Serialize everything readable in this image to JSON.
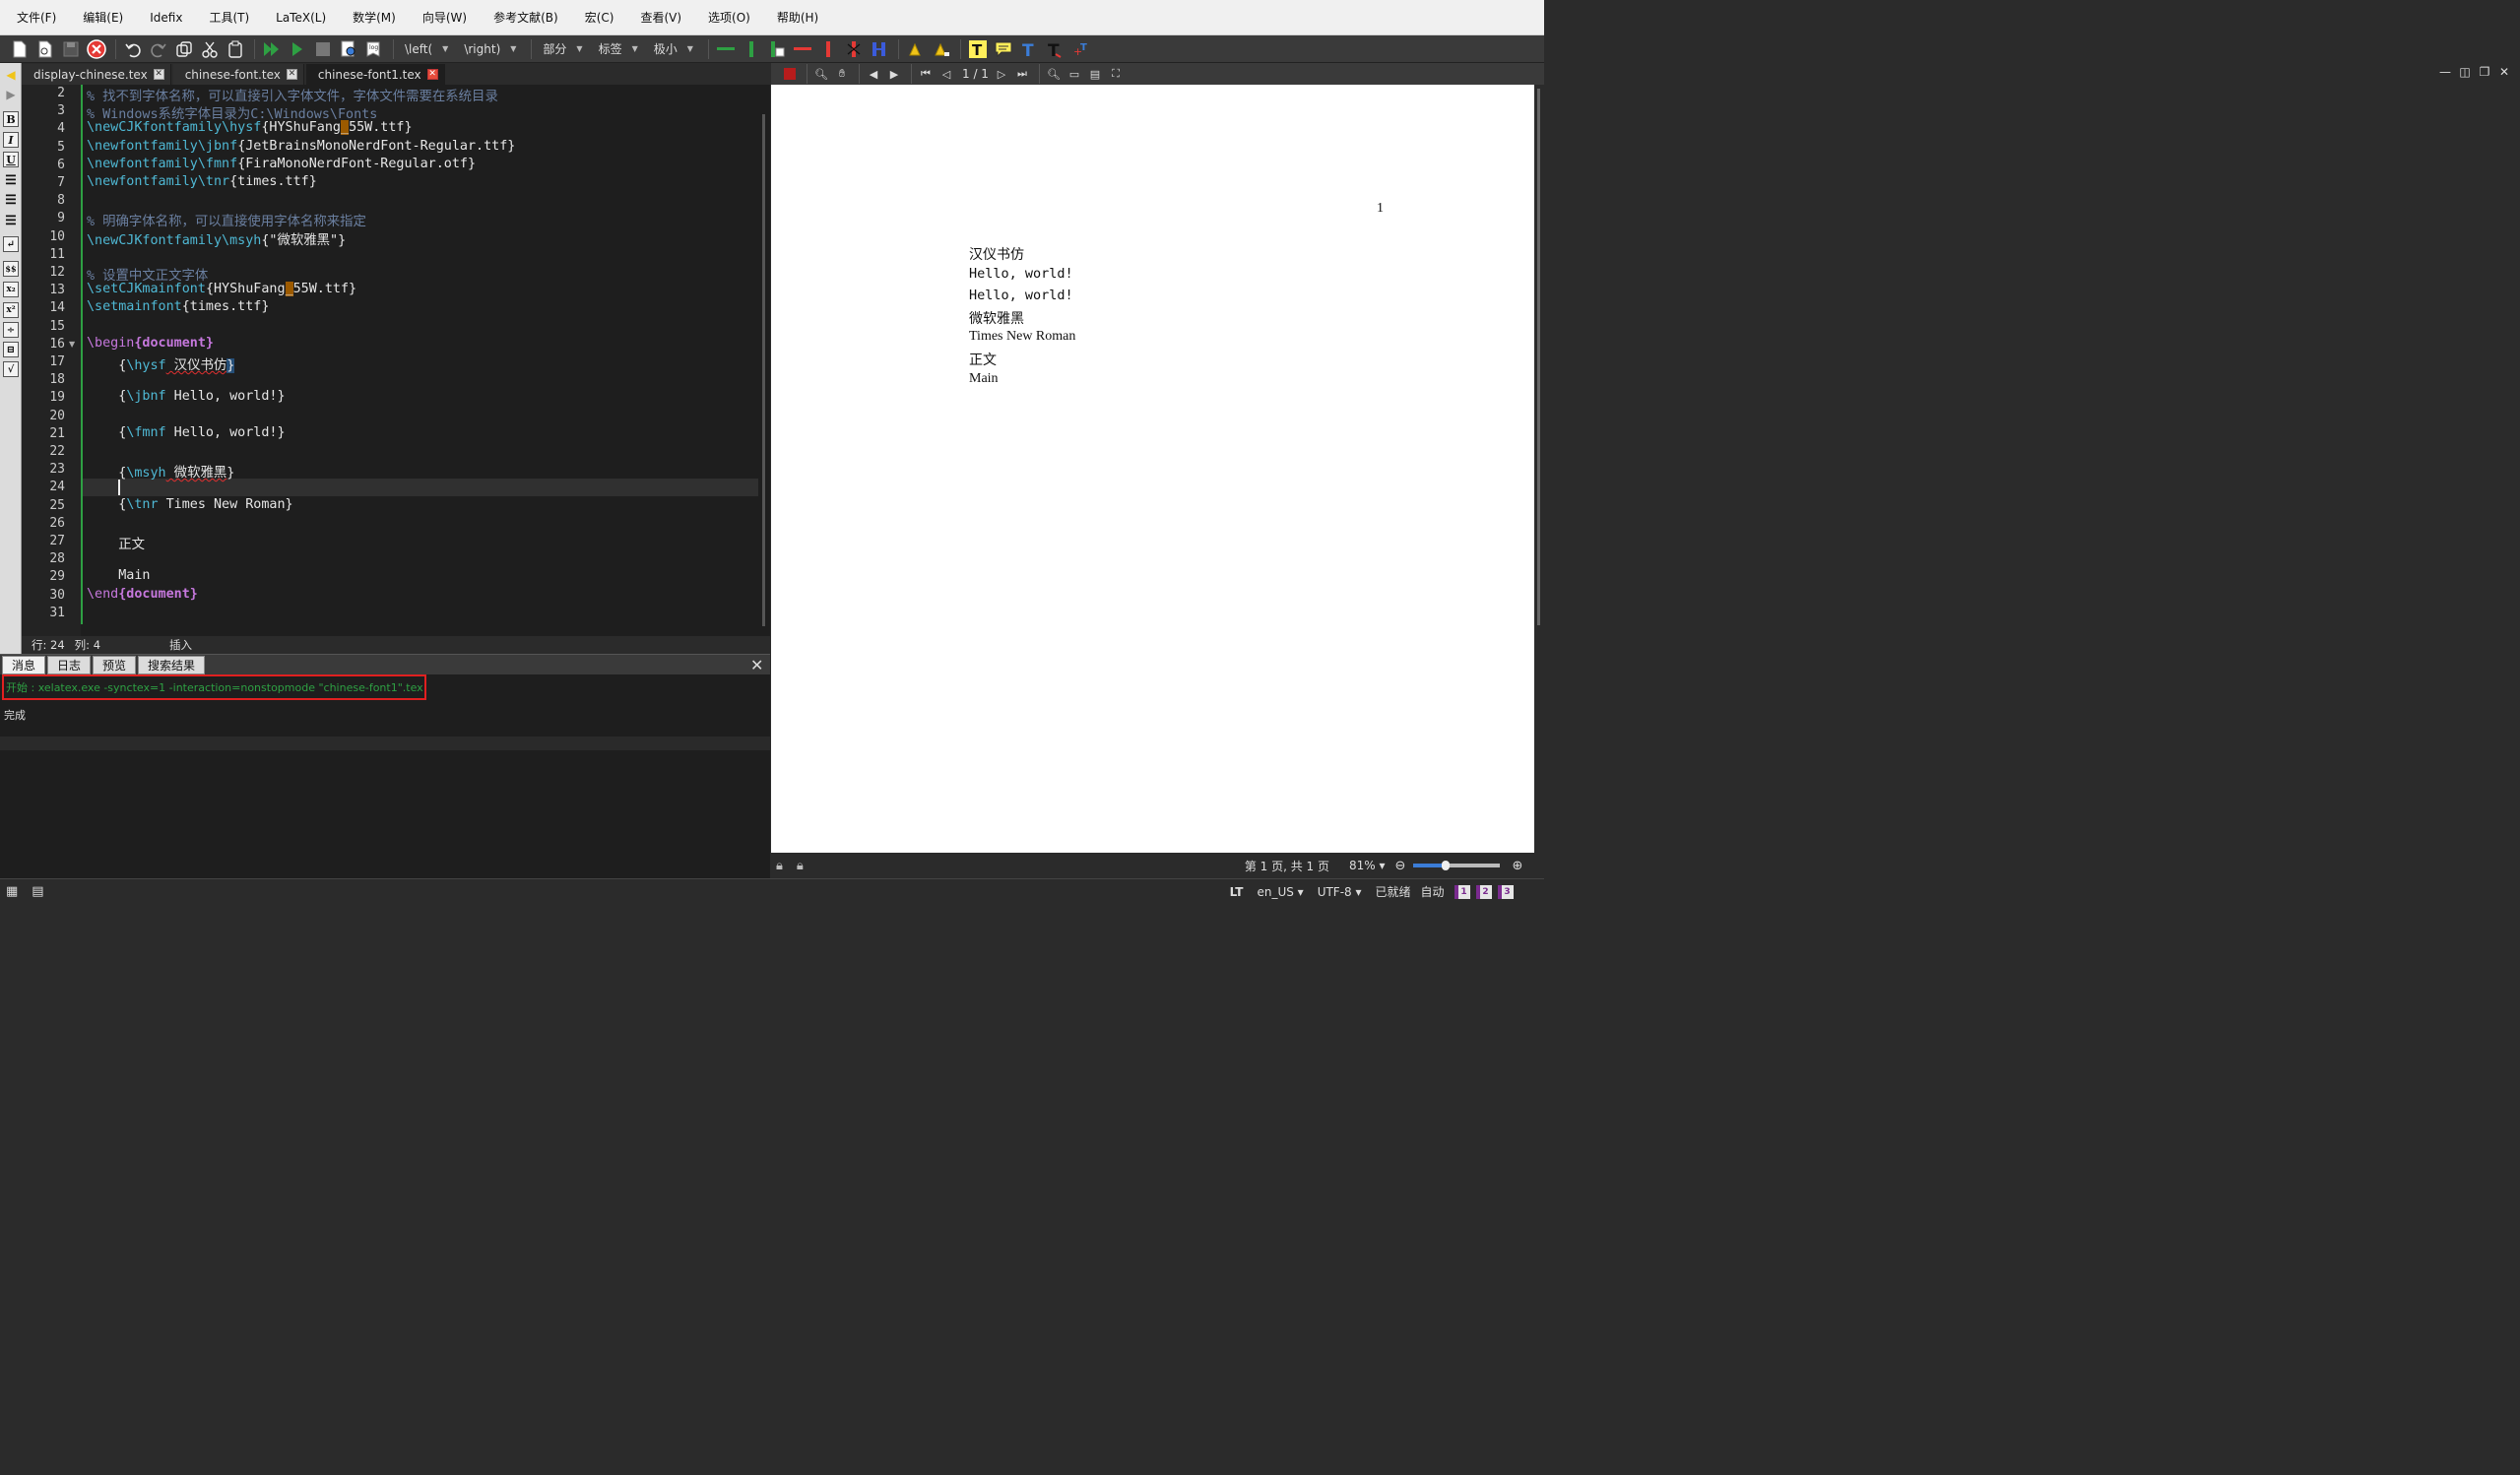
{
  "menu": [
    "文件(F)",
    "编辑(E)",
    "Idefix",
    "工具(T)",
    "LaTeX(L)",
    "数学(M)",
    "向导(W)",
    "参考文献(B)",
    "宏(C)",
    "查看(V)",
    "选项(O)",
    "帮助(H)"
  ],
  "toolbar": {
    "combo_left": "\\left(",
    "combo_right": "\\right)",
    "combo_part": "部分",
    "combo_label": "标签",
    "combo_size": "极小",
    "colors": {
      "compile": "#2ea043",
      "close": "#e53935",
      "accent_yellow": "#ffef5a"
    }
  },
  "tabs": [
    {
      "label": "display-chinese.tex",
      "active": false
    },
    {
      "label": "chinese-font.tex",
      "active": false
    },
    {
      "label": "chinese-font1.tex",
      "active": true
    }
  ],
  "editor": {
    "line_numbers": [
      "2",
      "3",
      "4",
      "5",
      "6",
      "7",
      "8",
      "9",
      "10",
      "11",
      "12",
      "13",
      "14",
      "15",
      "16",
      "17",
      "18",
      "19",
      "20",
      "21",
      "22",
      "23",
      "24",
      "25",
      "26",
      "27",
      "28",
      "29",
      "30",
      "31"
    ],
    "lines": {
      "l2": "% 找不到字体名称，可以直接引入字体文件，字体文件需要在系统目录",
      "l3": "% Windows系统字体目录为C:\\Windows\\Fonts",
      "l4_cmd": "\\newCJKfontfamily\\hysf",
      "l4_a": "{HYShuFang",
      "l4_b": "_",
      "l4_c": "55W.ttf}",
      "l5_cmd": "\\newfontfamily\\jbnf",
      "l5_arg": "{JetBrainsMonoNerdFont-Regular.ttf}",
      "l6_cmd": "\\newfontfamily\\fmnf",
      "l6_arg": "{FiraMonoNerdFont-Regular.otf}",
      "l7_cmd": "\\newfontfamily\\tnr",
      "l7_arg": "{times.ttf}",
      "l9": "% 明确字体名称，可以直接使用字体名称来指定",
      "l10_cmd": "\\newCJKfontfamily\\msyh",
      "l10_arg": "{\"微软雅黑\"}",
      "l12": "% 设置中文正文字体",
      "l13_cmd": "\\setCJKmainfont",
      "l13_a": "{HYShuFang",
      "l13_b": "_",
      "l13_c": "55W.ttf}",
      "l14_cmd": "\\setmainfont",
      "l14_arg": "{times.ttf}",
      "l16_cmd": "\\begin",
      "l16_env": "{document}",
      "l17_open": "    {",
      "l17_cmd": "\\hysf",
      "l17_text": " 汉仪书仿",
      "l17_close": "}",
      "l19_open": "    {",
      "l19_cmd": "\\jbnf",
      "l19_text": " Hello, world!}",
      "l21_open": "    {",
      "l21_cmd": "\\fmnf",
      "l21_text": " Hello, world!}",
      "l23_open": "    {",
      "l23_cmd": "\\msyh",
      "l23_text": " 微软雅黑",
      "l23_close": "}",
      "l25_open": "    {",
      "l25_cmd": "\\tnr",
      "l25_text": " Times New Roman}",
      "l27": "    正文",
      "l29": "    Main",
      "l30_cmd": "\\end",
      "l30_env": "{document}"
    }
  },
  "status": {
    "row_label": "行: 24",
    "col_label": "列: 4",
    "mode": "插入"
  },
  "messages": {
    "tabs": [
      "消息",
      "日志",
      "预览",
      "搜索结果"
    ],
    "line1": "开始 : xelatex.exe -synctex=1 -interaction=nonstopmode \"chinese-font1\".tex",
    "line2": "完成"
  },
  "pdf": {
    "page_indicator": "1 / 1",
    "page_number": "1",
    "lines": [
      "汉仪书仿",
      "Hello, world!",
      "Hello, world!",
      "微软雅黑",
      "Times New Roman",
      "正文",
      "Main"
    ],
    "page_status": "第 1 页, 共 1 页",
    "zoom": "81%"
  },
  "bottom": {
    "lt": "LT",
    "lang": "en_US",
    "encoding": "UTF-8",
    "ready": "已就绪",
    "auto": "自动",
    "badges": [
      "1",
      "2",
      "3"
    ]
  }
}
